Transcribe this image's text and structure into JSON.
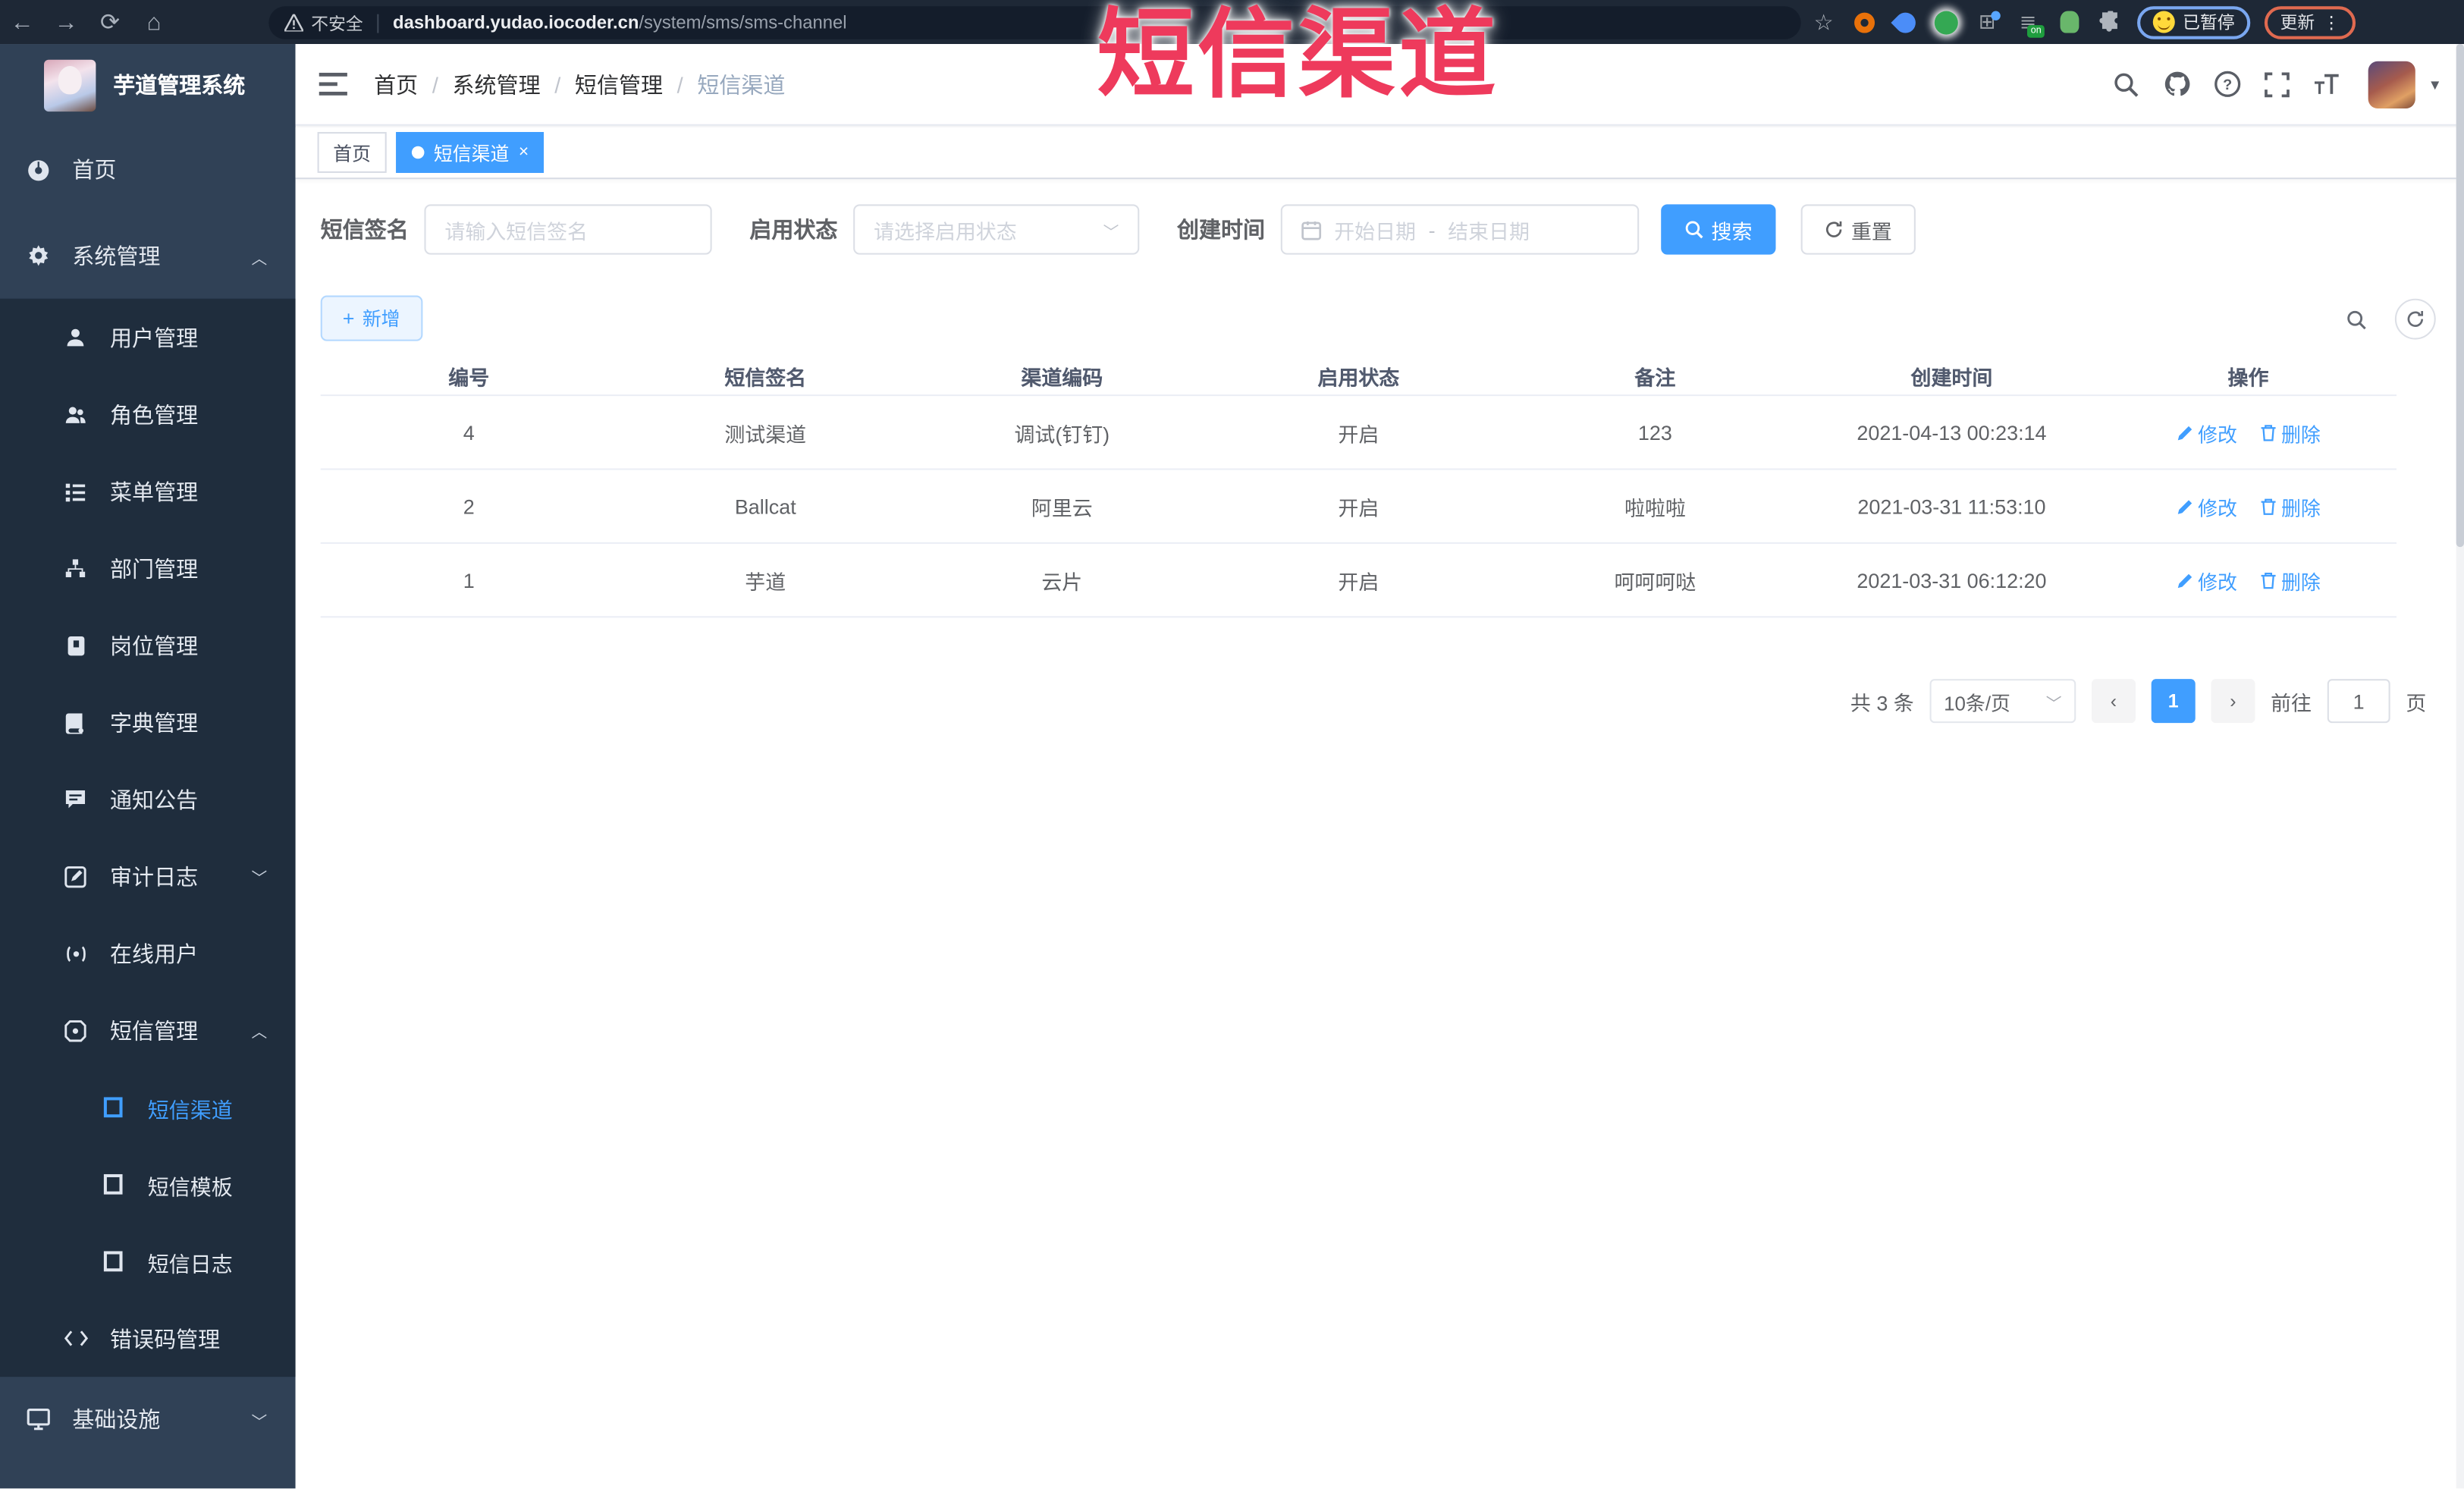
{
  "annotation": {
    "title": "短信渠道",
    "color": "#ee3a5c"
  },
  "browser": {
    "security_label": "不安全",
    "url_domain": "dashboard.yudao.iocoder.cn",
    "url_path": "/system/sms/sms-channel",
    "extension_badge": "on",
    "paused_label": "已暂停",
    "update_label": "更新"
  },
  "sidebar": {
    "app_title": "芋道管理系统",
    "items": {
      "home": "首页",
      "system": "系统管理",
      "user": "用户管理",
      "role": "角色管理",
      "menu": "菜单管理",
      "dept": "部门管理",
      "post": "岗位管理",
      "dict": "字典管理",
      "notice": "通知公告",
      "audit": "审计日志",
      "online": "在线用户",
      "sms": "短信管理",
      "sms_channel": "短信渠道",
      "sms_template": "短信模板",
      "sms_log": "短信日志",
      "errcode": "错误码管理",
      "infra": "基础设施"
    }
  },
  "header": {
    "breadcrumb": [
      "首页",
      "系统管理",
      "短信管理",
      "短信渠道"
    ]
  },
  "tabs": {
    "home": "首页",
    "current": "短信渠道"
  },
  "filters": {
    "sign_label": "短信签名",
    "sign_placeholder": "请输入短信签名",
    "status_label": "启用状态",
    "status_placeholder": "请选择启用状态",
    "time_label": "创建时间",
    "start_placeholder": "开始日期",
    "range_separator": "-",
    "end_placeholder": "结束日期",
    "search_label": "搜索",
    "reset_label": "重置"
  },
  "toolbar": {
    "add_label": "新增"
  },
  "table": {
    "columns": [
      "编号",
      "短信签名",
      "渠道编码",
      "启用状态",
      "备注",
      "创建时间",
      "操作"
    ],
    "edit_label": "修改",
    "delete_label": "删除",
    "rows": [
      {
        "id": "4",
        "sign": "测试渠道",
        "code": "调试(钉钉)",
        "status": "开启",
        "remark": "123",
        "created": "2021-04-13 00:23:14"
      },
      {
        "id": "2",
        "sign": "Ballcat",
        "code": "阿里云",
        "status": "开启",
        "remark": "啦啦啦",
        "created": "2021-03-31 11:53:10"
      },
      {
        "id": "1",
        "sign": "芋道",
        "code": "云片",
        "status": "开启",
        "remark": "呵呵呵哒",
        "created": "2021-03-31 06:12:20"
      }
    ]
  },
  "pagination": {
    "total": "共 3 条",
    "page_size": "10条/页",
    "current_page": "1",
    "goto_label": "前往",
    "page_unit": "页"
  },
  "colors": {
    "accent": "#409eff",
    "sidebar_bg": "#304156",
    "submenu_bg": "#1f2d3d",
    "annotation": "#ee3a5c"
  }
}
